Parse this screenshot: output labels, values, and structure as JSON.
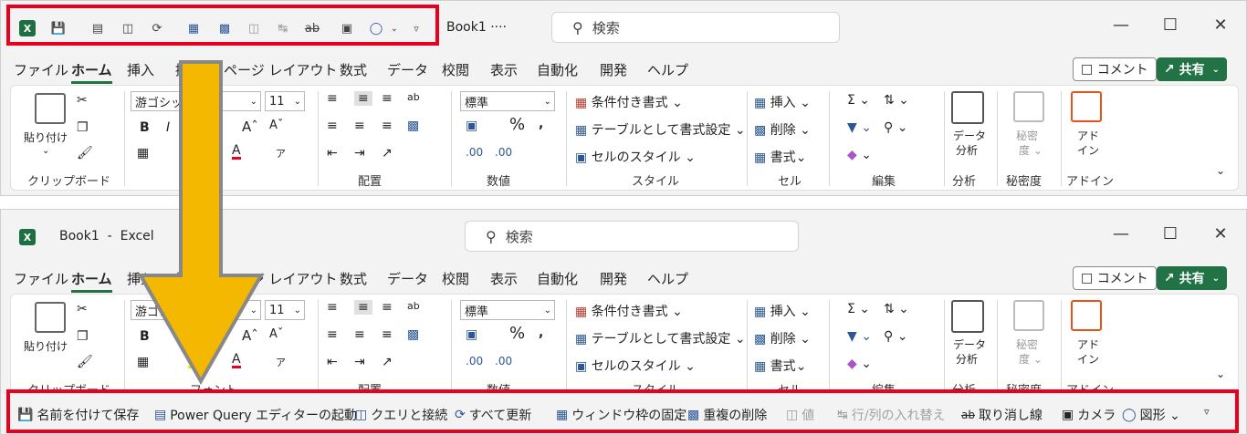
{
  "before": {
    "qat_icons": [
      "excel-logo-icon",
      "save-as-icon",
      "power-query-icon",
      "queries-connections-icon",
      "refresh-all-icon",
      "freeze-panes-icon",
      "remove-duplicates-icon",
      "values-icon",
      "transpose-icon",
      "strikethrough-icon",
      "camera-icon",
      "shapes-icon",
      "chevron-down-icon",
      "customize-qat-icon"
    ],
    "title": "Book1 ····",
    "search_placeholder": "検索"
  },
  "after": {
    "app_letter": "X",
    "title": "Book1  -  Excel",
    "search_placeholder": "検索"
  },
  "window_controls": {
    "minimize": "—",
    "maximize": "☐",
    "close": "✕"
  },
  "menu": {
    "tabs": [
      "ファイル",
      "ホーム",
      "挿入",
      "描画",
      "ページ レイアウト",
      "数式",
      "データ",
      "校閲",
      "表示",
      "自動化",
      "開発",
      "ヘルプ"
    ],
    "comment": "コメント",
    "share": "共有"
  },
  "ribbon": {
    "paste": "貼り付け",
    "clipboard": "クリップボード",
    "font_name": "游ゴシック",
    "font_size": "11",
    "bold": "B",
    "italic": "I",
    "font_grow": "Aˆ",
    "font_shrink": "Aˇ",
    "font": "フォント",
    "alignment": "配置",
    "number_format": "標準",
    "percent": "%",
    "comma": "Ȿ",
    "number": "数値",
    "cond_format": "条件付き書式 ⌄",
    "table_format": "テーブルとして書式設定 ⌄",
    "cell_styles": "セルのスタイル ⌄",
    "styles": "スタイル",
    "insert": "挿入",
    "delete": "削除",
    "format": "書式",
    "cells": "セル",
    "editing": "編集",
    "data_analysis_1": "データ",
    "data_analysis_2": "分析",
    "analysis": "分析",
    "sensitivity_1": "秘密",
    "sensitivity_2": "度 ⌄",
    "sensitivity": "秘密度",
    "addin_1": "アド",
    "addin_2": "イン",
    "addins": "アドイン"
  },
  "qat_bottom": {
    "items": [
      {
        "label": "名前を付けて保存",
        "icon": "save-as-icon",
        "disabled": false
      },
      {
        "label": "Power Query エディターの起動",
        "icon": "power-query-icon",
        "disabled": false
      },
      {
        "label": "クエリと接続",
        "icon": "queries-connections-icon",
        "disabled": false
      },
      {
        "label": "すべて更新",
        "icon": "refresh-all-icon",
        "disabled": false
      },
      {
        "label": "ウィンドウ枠の固定",
        "icon": "freeze-panes-icon",
        "disabled": false
      },
      {
        "label": "重複の削除",
        "icon": "remove-duplicates-icon",
        "disabled": false
      },
      {
        "label": "値",
        "icon": "values-icon",
        "disabled": true
      },
      {
        "label": "行/列の入れ替え",
        "icon": "transpose-icon",
        "disabled": true
      },
      {
        "label": "取り消し線",
        "icon": "strikethrough-icon",
        "disabled": false
      },
      {
        "label": "カメラ",
        "icon": "camera-icon",
        "disabled": false
      },
      {
        "label": "図形 ⌄",
        "icon": "shapes-icon",
        "disabled": false
      }
    ],
    "customize": "▿"
  },
  "colors": {
    "excel_green": "#217346",
    "highlight": "#e8001c",
    "arrow_fill": "#f5b800",
    "arrow_stroke": "#888888"
  }
}
